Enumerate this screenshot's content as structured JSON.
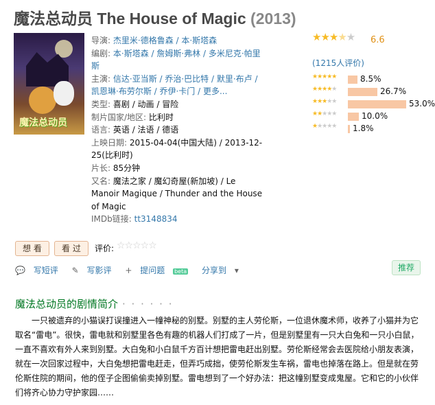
{
  "title": {
    "zh": "魔法总动员",
    "en": "The House of Magic",
    "year": "(2013)"
  },
  "poster": {
    "title": "魔法总动员"
  },
  "info": {
    "director_label": "导演:",
    "director": "杰里米·德格鲁森 / 本·斯塔森",
    "writer_label": "编剧:",
    "writer": "本·斯塔森 / 詹姆斯·弗林 / 多米尼克·帕里斯",
    "cast_label": "主演:",
    "cast": "信达·亚当斯 / 乔治·巴比特 / 默里·布卢 / 凯恩琳·布劳尔斯 / 乔伊·卡门 / 更多...",
    "genre_label": "类型:",
    "genre": "喜剧 / 动画 / 冒险",
    "country_label": "制片国家/地区:",
    "country": "比利时",
    "language_label": "语言:",
    "language": "英语 / 法语 / 德语",
    "release_label": "上映日期:",
    "release": "2015-04-04(中国大陆) / 2013-12-25(比利时)",
    "runtime_label": "片长:",
    "runtime": "85分钟",
    "aka_label": "又名:",
    "aka": "魔法之家 / 魔幻奇屋(新加坡) / Le Manoir Magique / Thunder and the House of Magic",
    "imdb_label": "IMDb链接:",
    "imdb": "tt3148834"
  },
  "rating": {
    "score": "6.6",
    "votes": "(1215人评价)",
    "dist": [
      {
        "stars": 5,
        "pct": "8.5%",
        "value": 8.5
      },
      {
        "stars": 4,
        "pct": "26.7%",
        "value": 26.7
      },
      {
        "stars": 3,
        "pct": "53.0%",
        "value": 53.0
      },
      {
        "stars": 2,
        "pct": "10.0%",
        "value": 10.0
      },
      {
        "stars": 1,
        "pct": "1.8%",
        "value": 1.8
      }
    ]
  },
  "buttons": {
    "want": "想 看",
    "seen": "看 过",
    "rate_label": "评价:"
  },
  "actions": {
    "review_short": "写短评",
    "review_long": "写影评",
    "question": "提问题",
    "beta": "beta",
    "share": "分享到",
    "recommend": "推荐"
  },
  "synopsis": {
    "heading": "魔法总动员的剧情简介",
    "dots": "· · · · · ·",
    "text": "一只被遗弃的小猫误打误撞进入一幢神秘的别墅。别墅的主人劳伦斯，一位退休魔术师，收养了小猫并为它取名“雷电”。很快，雷电就和别墅里各色有趣的机器人们打成了一片，但是别墅里有一只大白兔和一只小白鼠，一直不喜欢有外人来到别墅。大白兔和小白鼠千方百计想把雷电赶出别墅。劳伦斯经常会去医院给小朋友表演，就在一次回家过程中，大白兔想把雷电赶走，但弄巧成拙，使劳伦斯发生车祸，雷电也掉落在路上。但是就在劳伦斯住院的期间，他的侄子企图偷偷卖掉别墅。雷电想到了一个好办法：把这幢别墅变成鬼屋。它和它的小伙伴们将齐心协力守护家园……"
  },
  "colors": {
    "star": "#f7bb26",
    "bar": "#f8c7a4",
    "link": "#3377aa",
    "green": "#007722"
  }
}
